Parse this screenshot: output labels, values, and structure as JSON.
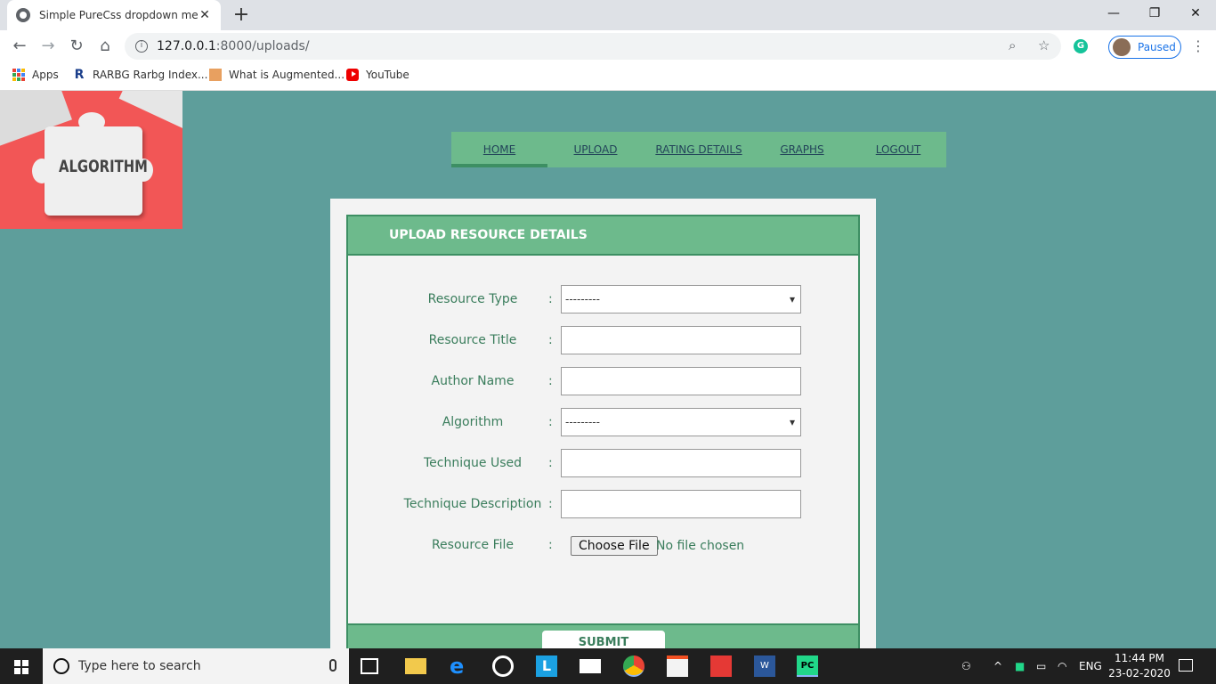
{
  "browser": {
    "tab_title": "Simple PureCss dropdown menu",
    "tab_close": "✕",
    "new_tab": "+",
    "url_host": "127.0.0.1",
    "url_rest": ":8000/uploads/",
    "profile_status": "Paused",
    "bookmarks": [
      {
        "label": "Apps"
      },
      {
        "label": "RARBG Rarbg Index..."
      },
      {
        "label": "What is Augmented..."
      },
      {
        "label": "YouTube"
      }
    ]
  },
  "logo": {
    "text": "ALGORITHM"
  },
  "nav": {
    "items": [
      {
        "label": "HOME"
      },
      {
        "label": "UPLOAD"
      },
      {
        "label": "RATING DETAILS"
      },
      {
        "label": "GRAPHS"
      },
      {
        "label": "LOGOUT"
      }
    ]
  },
  "form": {
    "heading": "UPLOAD RESOURCE DETAILS",
    "colon": ":",
    "fields": [
      {
        "label": "Resource Type",
        "value": "---------"
      },
      {
        "label": "Resource Title",
        "value": ""
      },
      {
        "label": "Author Name",
        "value": ""
      },
      {
        "label": "Algorithm",
        "value": "---------"
      },
      {
        "label": "Technique Used",
        "value": ""
      },
      {
        "label": "Technique Description",
        "value": ""
      },
      {
        "label": "Resource File",
        "button": "Choose File",
        "status": "No file chosen"
      }
    ],
    "submit_label": "SUBMIT"
  },
  "taskbar": {
    "search_placeholder": "Type here to search",
    "language": "ENG",
    "time": "11:44 PM",
    "date": "23-02-2020"
  }
}
